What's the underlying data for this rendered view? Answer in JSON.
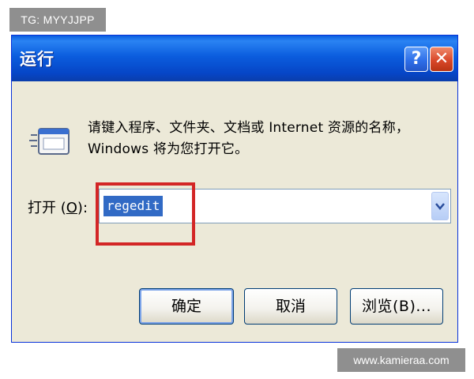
{
  "overlays": {
    "tg_tag": "TG: MYYJJPP",
    "site_url": "www.kamieraa.com"
  },
  "dialog": {
    "title": "运行",
    "help_glyph": "?",
    "close_glyph": "✕",
    "description": "请键入程序、文件夹、文档或 Internet 资源的名称，Windows 将为您打开它。",
    "open_label_prefix": "打开 (",
    "open_label_accel": "O",
    "open_label_suffix": "):",
    "open_value": "regedit",
    "dropdown_glyph": "⌄",
    "buttons": {
      "ok": "确定",
      "cancel": "取消",
      "browse": "浏览(B)..."
    }
  },
  "colors": {
    "titlebar": "#0a5ee0",
    "dialog_bg": "#ece9d8",
    "selection": "#316ac5",
    "highlight_box": "#d32626"
  },
  "icons": {
    "help": "help-icon",
    "close": "close-icon",
    "run": "run-icon",
    "dropdown": "chevron-down-icon"
  }
}
